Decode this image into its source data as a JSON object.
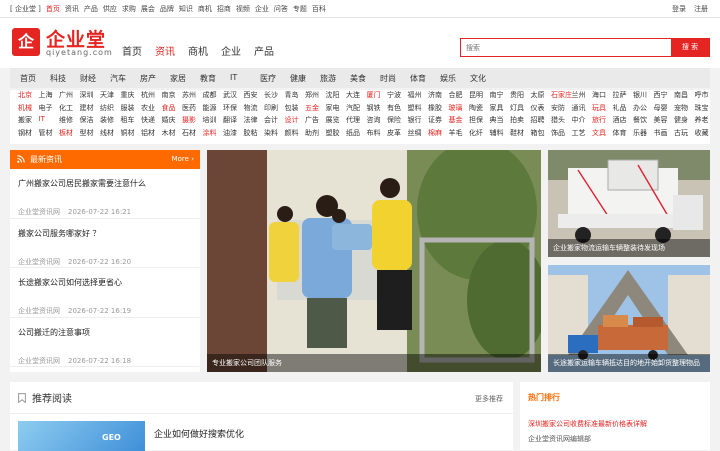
{
  "topbar": {
    "left_items": [
      "[ 企业堂 ]",
      "首页",
      "资讯",
      "产品",
      "供应",
      "求购",
      "展会",
      "品牌",
      "知识",
      "商机",
      "招商",
      "视频",
      "企业",
      "问答",
      "专题",
      "百科"
    ],
    "right_items": [
      "登录",
      "注册"
    ]
  },
  "logo": {
    "cn": "企业堂",
    "en": "qiyetang.com",
    "mark": "企"
  },
  "header_nav": [
    {
      "label": "首页",
      "active": false
    },
    {
      "label": "资讯",
      "active": true
    },
    {
      "label": "商机",
      "active": false
    },
    {
      "label": "企业",
      "active": false
    },
    {
      "label": "产品",
      "active": false
    }
  ],
  "search": {
    "placeholder": "搜索",
    "button": "搜 索"
  },
  "categories": [
    "首页",
    "科技",
    "财经",
    "汽车",
    "房产",
    "家居",
    "教育",
    "IT",
    "医疗",
    "健康",
    "旅游",
    "美食",
    "时尚",
    "体育",
    "娱乐",
    "文化"
  ],
  "subcategories": [
    [
      "北京",
      "上海",
      "广州",
      "深圳",
      "天津",
      "重庆",
      "杭州",
      "南京",
      "苏州",
      "成都",
      "武汉",
      "西安",
      "长沙",
      "青岛",
      "郑州",
      "沈阳",
      "大连",
      "厦门",
      "宁波",
      "福州",
      "济南",
      "合肥",
      "昆明",
      "南宁",
      "贵阳",
      "太原",
      "石家庄",
      "兰州",
      "海口",
      "拉萨",
      "银川",
      "西宁",
      "南昌",
      "呼市"
    ],
    [
      "机械",
      "电子",
      "化工",
      "建材",
      "纺织",
      "服装",
      "农业",
      "食品",
      "医药",
      "能源",
      "环保",
      "物流",
      "印刷",
      "包装",
      "五金",
      "家电",
      "汽配",
      "钢铁",
      "有色",
      "塑料",
      "橡胶",
      "玻璃",
      "陶瓷",
      "家具",
      "灯具",
      "仪表",
      "安防",
      "通讯",
      "玩具",
      "礼品",
      "办公",
      "母婴",
      "宠物",
      "珠宝"
    ],
    [
      "搬家",
      "IT",
      "维修",
      "保洁",
      "装修",
      "租车",
      "快递",
      "婚庆",
      "摄影",
      "培训",
      "翻译",
      "法律",
      "会计",
      "设计",
      "广告",
      "展览",
      "代理",
      "咨询",
      "保险",
      "银行",
      "证券",
      "基金",
      "担保",
      "典当",
      "拍卖",
      "招聘",
      "猎头",
      "中介",
      "旅行",
      "酒店",
      "餐饮",
      "美容",
      "健身",
      "养老"
    ],
    [
      "钢材",
      "管材",
      "板材",
      "型材",
      "线材",
      "铜材",
      "铝材",
      "木材",
      "石材",
      "涂料",
      "油漆",
      "胶粘",
      "染料",
      "颜料",
      "助剂",
      "塑胶",
      "纸品",
      "布料",
      "皮革",
      "丝绸",
      "棉麻",
      "羊毛",
      "化纤",
      "辅料",
      "鞋材",
      "箱包",
      "饰品",
      "工艺",
      "文具",
      "体育",
      "乐器",
      "书画",
      "古玩",
      "收藏"
    ]
  ],
  "news": {
    "header": "最新资讯",
    "more": "More ›",
    "items": [
      {
        "title": "广州搬家公司居民搬家需要注意什么",
        "source": "企业堂资讯网",
        "time": "2026-07-22 16:21"
      },
      {
        "title": "搬家公司服务哪家好 ？",
        "source": "企业堂资讯网",
        "time": "2026-07-22 16:20"
      },
      {
        "title": "长途搬家公司如何选择更省心",
        "source": "企业堂资讯网",
        "time": "2026-07-22 16:19"
      },
      {
        "title": "公司搬迁的注意事项",
        "source": "企业堂资讯网",
        "time": "2026-07-22 16:18"
      }
    ]
  },
  "feature": {
    "caption": "专业搬家公司团队服务"
  },
  "side_cards": [
    {
      "caption": "企业搬家物流运输车辆整装待发现场"
    },
    {
      "caption": "长途搬家运输车辆抵达目的地开始卸货整理物品"
    }
  ],
  "recommend": {
    "title": "推荐阅读",
    "more": "更多推荐",
    "item_title": "企业如何做好搜索优化",
    "img_text": "GEO"
  },
  "hot": {
    "title": "热门排行",
    "item1": "深圳搬家公司收费标准最新价格表详解",
    "item2": "企业堂资讯网编辑部"
  },
  "colors": {
    "brand_red": "#e52521",
    "accent_orange": "#ff6a00"
  }
}
